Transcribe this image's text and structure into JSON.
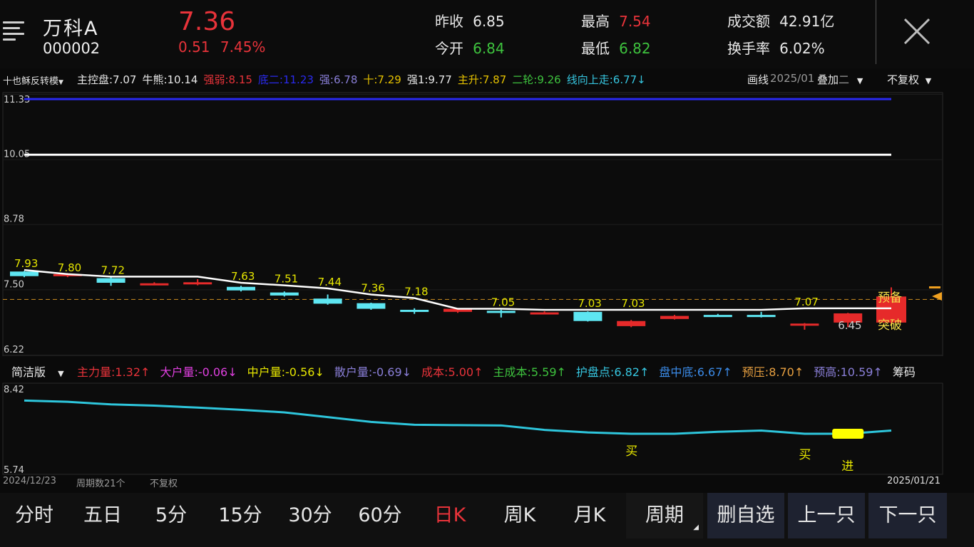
{
  "stock": {
    "name": "万科A",
    "code": "000002",
    "price": "7.36",
    "change": "0.51",
    "change_pct": "7.45%"
  },
  "stats": [
    {
      "label": "昨收",
      "value": "6.85",
      "color": "#e8e8e8"
    },
    {
      "label": "今开",
      "value": "6.84",
      "color": "#3ec33e"
    },
    {
      "label": "最高",
      "value": "7.54",
      "color": "#e8333a"
    },
    {
      "label": "最低",
      "value": "6.82",
      "color": "#3ec33e"
    },
    {
      "label": "成交额",
      "value": "42.91亿",
      "color": "#e8e8e8"
    },
    {
      "label": "换手率",
      "value": "6.02%",
      "color": "#e8e8e8"
    }
  ],
  "indicators": {
    "selector": "十也稣反转模",
    "items": [
      {
        "text": "主控盘:7.07",
        "color": "#e8e8e8"
      },
      {
        "text": "牛熊:10.14",
        "color": "#e8e8e8"
      },
      {
        "text": "强弱:8.15",
        "color": "#e8333a"
      },
      {
        "text": "底二:11.23",
        "color": "#2a2af0"
      },
      {
        "text": "强:6.78",
        "color": "#8a7fd8"
      },
      {
        "text": "十:7.29",
        "color": "#e6c200"
      },
      {
        "text": "强1:9.77",
        "color": "#e8e8e8"
      },
      {
        "text": "主升:7.87",
        "color": "#e6c200"
      },
      {
        "text": "二轮:9.26",
        "color": "#3ec33e"
      },
      {
        "text": "线向上走:6.77↓",
        "color": "#36c6e0"
      }
    ],
    "draw_line": "画线",
    "date_overlap": "2025/01",
    "overlay": "叠加",
    "overlay_tail": "二",
    "no_adjust": "不复权"
  },
  "main_axis": {
    "labels": [
      "11.33",
      "10.05",
      "8.78",
      "7.50",
      "6.22"
    ]
  },
  "candle_labels": [
    "7.93",
    "7.80",
    "7.72",
    "7.63",
    "7.51",
    "7.44",
    "7.36",
    "7.18",
    "7.05",
    "7.03",
    "7.03",
    "7.07",
    "6.45"
  ],
  "signals": {
    "prepare": "预备",
    "breakout": "突破"
  },
  "sub_indicator": {
    "mode": "简洁版",
    "items": [
      {
        "text": "主力量:1.32↑",
        "color": "#e8333a"
      },
      {
        "text": "大户量:-0.06↓",
        "color": "#e040e0"
      },
      {
        "text": "中户量:-0.56↓",
        "color": "#e6e600"
      },
      {
        "text": "散户量:-0.69↓",
        "color": "#8a7fd8"
      },
      {
        "text": "成本:5.00↑",
        "color": "#e8333a"
      },
      {
        "text": "主成本:5.59↑",
        "color": "#3ec33e"
      },
      {
        "text": "护盘点:6.82↑",
        "color": "#36c6e0"
      },
      {
        "text": "盘中底:6.67↑",
        "color": "#3b8be8"
      },
      {
        "text": "预压:8.70↑",
        "color": "#e8a040"
      },
      {
        "text": "预高:10.59↑",
        "color": "#8a7fd8"
      },
      {
        "text": "筹码",
        "color": "#e8e8e8"
      }
    ],
    "axis_top": "8.42",
    "axis_bottom": "5.74",
    "buy_labels": [
      "买",
      "买"
    ],
    "enter_label": "进"
  },
  "footer_info": {
    "start_date": "2024/12/23",
    "periods": "周期数21个",
    "adjust": "不复权",
    "end_date": "2025/01/21"
  },
  "nav": {
    "tabs": [
      "分时",
      "五日",
      "5分",
      "15分",
      "30分",
      "60分",
      "日K",
      "周K",
      "月K"
    ],
    "active": "日K",
    "period": "周期",
    "buttons": [
      "删自选",
      "上一只",
      "下一只"
    ]
  },
  "chart_data": {
    "type": "candlestick",
    "ylim": [
      6.22,
      11.33
    ],
    "candles": [
      {
        "open": 7.76,
        "close": 7.85,
        "high": 7.86,
        "low": 7.74,
        "dir": "down"
      },
      {
        "open": 7.8,
        "close": 7.78,
        "high": 7.82,
        "low": 7.74,
        "dir": "up"
      },
      {
        "open": 7.72,
        "close": 7.63,
        "high": 7.75,
        "low": 7.57,
        "dir": "down"
      },
      {
        "open": 7.6,
        "close": 7.62,
        "high": 7.64,
        "low": 7.58,
        "dir": "up"
      },
      {
        "open": 7.6,
        "close": 7.64,
        "high": 7.7,
        "low": 7.58,
        "dir": "up"
      },
      {
        "open": 7.55,
        "close": 7.48,
        "high": 7.57,
        "low": 7.46,
        "dir": "down"
      },
      {
        "open": 7.44,
        "close": 7.38,
        "high": 7.46,
        "low": 7.36,
        "dir": "down"
      },
      {
        "open": 7.32,
        "close": 7.22,
        "high": 7.4,
        "low": 7.2,
        "dir": "down"
      },
      {
        "open": 7.23,
        "close": 7.12,
        "high": 7.24,
        "low": 7.1,
        "dir": "down"
      },
      {
        "open": 7.1,
        "close": 7.08,
        "high": 7.13,
        "low": 7.02,
        "dir": "down"
      },
      {
        "open": 7.06,
        "close": 7.12,
        "high": 7.13,
        "low": 7.04,
        "dir": "up"
      },
      {
        "open": 7.08,
        "close": 7.05,
        "high": 7.1,
        "low": 6.95,
        "dir": "down"
      },
      {
        "open": 7.04,
        "close": 7.05,
        "high": 7.07,
        "low": 7.03,
        "dir": "up"
      },
      {
        "open": 6.88,
        "close": 7.06,
        "high": 7.07,
        "low": 6.87,
        "dir": "down"
      },
      {
        "open": 6.88,
        "close": 6.78,
        "high": 6.9,
        "low": 6.76,
        "dir": "up"
      },
      {
        "open": 6.92,
        "close": 6.98,
        "high": 7.0,
        "low": 6.91,
        "dir": "up"
      },
      {
        "open": 7.0,
        "close": 6.97,
        "high": 7.02,
        "low": 6.96,
        "dir": "down"
      },
      {
        "open": 7.0,
        "close": 6.97,
        "high": 7.06,
        "low": 6.95,
        "dir": "down"
      },
      {
        "open": 6.8,
        "close": 6.83,
        "high": 6.84,
        "low": 6.71,
        "dir": "up"
      },
      {
        "open": 6.85,
        "close": 7.03,
        "high": 7.04,
        "low": 6.76,
        "dir": "up"
      },
      {
        "open": 6.85,
        "close": 7.36,
        "high": 7.54,
        "low": 6.82,
        "dir": "up"
      }
    ],
    "ma_line": [
      7.88,
      7.8,
      7.75,
      7.75,
      7.75,
      7.63,
      7.58,
      7.52,
      7.4,
      7.33,
      7.12,
      7.12,
      7.1,
      7.1,
      7.1,
      7.1,
      7.1,
      7.1,
      7.13,
      7.13,
      7.13
    ],
    "level_lines": [
      {
        "value": 11.23,
        "color": "#2a2af0"
      },
      {
        "value": 10.14,
        "color": "#ffffff"
      }
    ],
    "reference_price": 7.36,
    "sub_series": [
      7.92,
      7.88,
      7.8,
      7.76,
      7.7,
      7.63,
      7.55,
      7.4,
      7.25,
      7.16,
      7.15,
      7.14,
      7.0,
      6.92,
      6.88,
      6.88,
      6.94,
      6.98,
      6.88,
      6.88,
      6.98
    ],
    "sub_ylim": [
      5.74,
      8.42
    ]
  }
}
